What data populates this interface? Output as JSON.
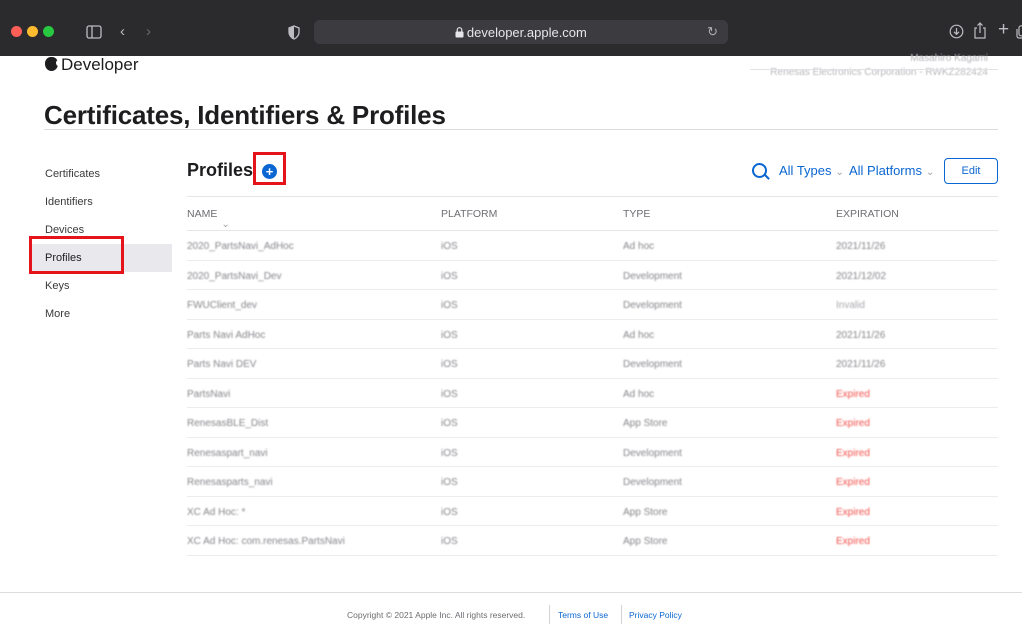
{
  "browser": {
    "url": "developer.apple.com",
    "colors": {
      "close": "#ff5f57",
      "minimize": "#febc2e",
      "zoom": "#28c840"
    }
  },
  "header": {
    "brand": "Developer",
    "account_name": "Masahiro Kagami",
    "account_team": "Renesas Electronics Corporation - RWKZ282424"
  },
  "page": {
    "title": "Certificates, Identifiers & Profiles"
  },
  "sidebar": {
    "items": [
      {
        "label": "Certificates",
        "active": false
      },
      {
        "label": "Identifiers",
        "active": false
      },
      {
        "label": "Devices",
        "active": false
      },
      {
        "label": "Profiles",
        "active": true
      },
      {
        "label": "Keys",
        "active": false
      },
      {
        "label": "More",
        "active": false
      }
    ]
  },
  "main": {
    "title": "Profiles",
    "add_icon": "plus-circle-icon",
    "filter_types": "All Types",
    "filter_platforms": "All Platforms",
    "edit_label": "Edit",
    "columns": {
      "name": "NAME",
      "platform": "PLATFORM",
      "type": "TYPE",
      "expiration": "EXPIRATION"
    },
    "rows": [
      {
        "name": "2020_PartsNavi_AdHoc",
        "platform": "iOS",
        "type": "Ad hoc",
        "expiration": "2021/11/26",
        "status": "active"
      },
      {
        "name": "2020_PartsNavi_Dev",
        "platform": "iOS",
        "type": "Development",
        "expiration": "2021/12/02",
        "status": "active"
      },
      {
        "name": "FWUClient_dev",
        "platform": "iOS",
        "type": "Development",
        "expiration": "Invalid",
        "status": "invalid"
      },
      {
        "name": "Parts Navi AdHoc",
        "platform": "iOS",
        "type": "Ad hoc",
        "expiration": "2021/11/26",
        "status": "active"
      },
      {
        "name": "Parts Navi DEV",
        "platform": "iOS",
        "type": "Development",
        "expiration": "2021/11/26",
        "status": "active"
      },
      {
        "name": "PartsNavi",
        "platform": "iOS",
        "type": "Ad hoc",
        "expiration": "Expired",
        "status": "expired"
      },
      {
        "name": "RenesasBLE_Dist",
        "platform": "iOS",
        "type": "App Store",
        "expiration": "Expired",
        "status": "expired"
      },
      {
        "name": "Renesaspart_navi",
        "platform": "iOS",
        "type": "Development",
        "expiration": "Expired",
        "status": "expired"
      },
      {
        "name": "Renesasparts_navi",
        "platform": "iOS",
        "type": "Development",
        "expiration": "Expired",
        "status": "expired"
      },
      {
        "name": "XC Ad Hoc: *",
        "platform": "iOS",
        "type": "App Store",
        "expiration": "Expired",
        "status": "expired"
      },
      {
        "name": "XC Ad Hoc: com.renesas.PartsNavi",
        "platform": "iOS",
        "type": "App Store",
        "expiration": "Expired",
        "status": "expired"
      }
    ]
  },
  "footer": {
    "copyright": "Copyright © 2021 Apple Inc. All rights reserved.",
    "terms": "Terms of Use",
    "privacy": "Privacy Policy"
  },
  "annotations": {
    "highlight_color": "#e5141a"
  }
}
